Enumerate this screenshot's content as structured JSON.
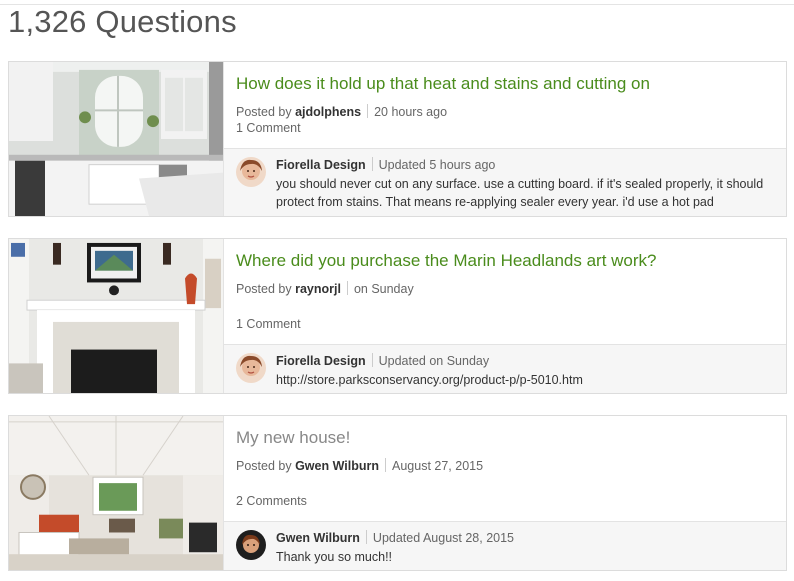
{
  "page": {
    "heading": "1,326 Questions"
  },
  "questions": [
    {
      "title": "How does it hold up that heat and stains and cutting on",
      "posted_prefix": "Posted by",
      "author": "ajdolphens",
      "time": "20 hours ago",
      "comments": "1 Comment",
      "reply": {
        "name": "Fiorella Design",
        "updated": "Updated 5 hours ago",
        "text": "you should never cut on any surface. use a cutting board. if it's sealed properly, it should protect from stains. That means re-applying sealer every year. i'd use a hot pad"
      }
    },
    {
      "title": "Where did you purchase the Marin Headlands art work?",
      "posted_prefix": "Posted by",
      "author": "raynorjl",
      "time": "on Sunday",
      "comments": "1 Comment",
      "reply": {
        "name": "Fiorella Design",
        "updated": "Updated on Sunday",
        "text": "http://store.parksconservancy.org/product-p/p-5010.htm"
      }
    },
    {
      "title": "My new house!",
      "posted_prefix": "Posted by",
      "author": "Gwen Wilburn",
      "time": "August 27, 2015",
      "comments": "2 Comments",
      "reply": {
        "name": "Gwen Wilburn",
        "updated": "Updated August 28, 2015",
        "text": "Thank you so much!!"
      }
    }
  ],
  "colors": {
    "title_green": "#4a8c1c",
    "title_grey": "#888888",
    "reply_bg": "#f6f6f6"
  },
  "thumbnails": [
    "white-kitchen-photo",
    "fireplace-living-room-photo",
    "coffered-living-room-photo"
  ]
}
